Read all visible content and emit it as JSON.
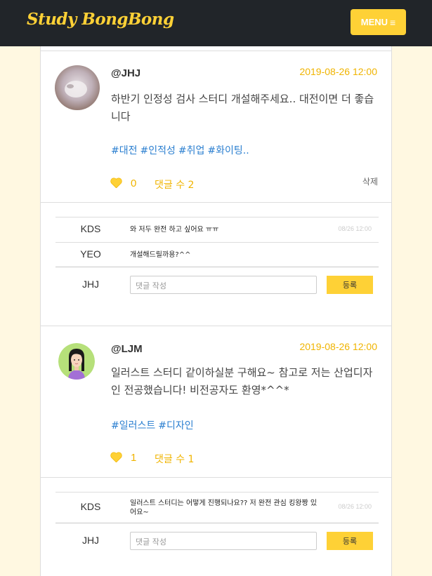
{
  "nav": {
    "brand": "Study BongBong",
    "menu_label": "MENU"
  },
  "posts": [
    {
      "user": "@JHJ",
      "date": "2019-08-26 12:00",
      "content": "하반기 인정성 검사 스터디 개설해주세요.. 대전이면 더 좋습니다",
      "tags": [
        "#대전",
        "#인적성",
        "#취업",
        "#화이팅.."
      ],
      "likes": "0",
      "comments_label": "댓글 수 2",
      "delete_label": "삭제",
      "comments": [
        {
          "user": "KDS",
          "text": "와 저두 완전 하고 싶어요 ㅠㅠ",
          "time": "08/26 12:00"
        },
        {
          "user": "YEO",
          "text": "개설해드릴까용?^^",
          "time": ""
        }
      ],
      "input_user": "JHJ",
      "input_placeholder": "댓글 작성",
      "submit_label": "등록"
    },
    {
      "user": "@LJM",
      "date": "2019-08-26 12:00",
      "content": "일러스트 스터디 같이하실분 구해요~ 참고로 저는 산업디자인 전공했습니다! 비전공자도 환영*^^*",
      "tags": [
        "#일러스트",
        "#디자인"
      ],
      "likes": "1",
      "comments_label": "댓글 수 1",
      "comments": [
        {
          "user": "KDS",
          "text": "일러스트 스터디는 어떻게 진행되나요?? 저 완전 관심 킹왕짱 있어요~",
          "time": "08/26 12:00"
        }
      ],
      "input_user": "JHJ",
      "input_placeholder": "댓글 작성",
      "submit_label": "등록"
    }
  ],
  "colors": {
    "accent": "#fed136",
    "nav_bg": "#212529",
    "tag": "#2b7fd0",
    "page_bg": "#fff8e1"
  }
}
